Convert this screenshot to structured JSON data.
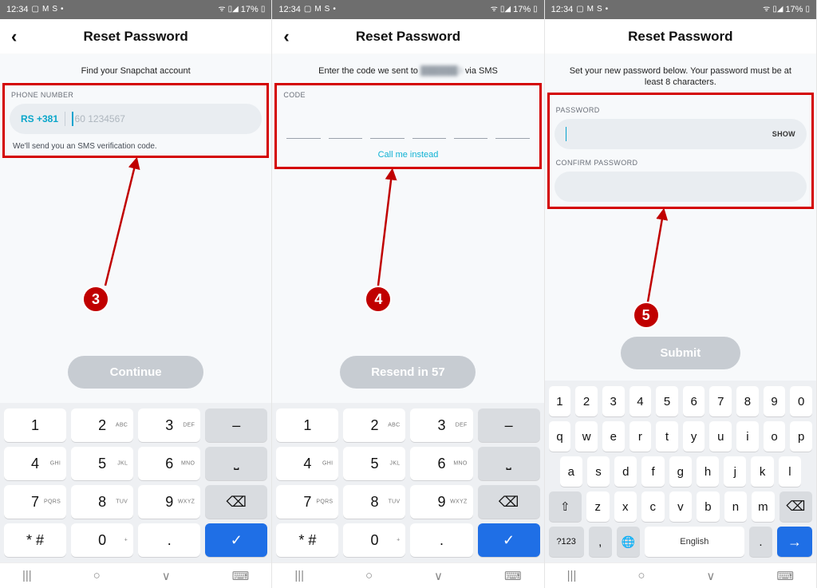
{
  "status": {
    "time": "12:34",
    "battery": "17%",
    "icons_left": [
      "image-icon",
      "mail-icon",
      "skype-icon",
      "dot-icon"
    ],
    "icons_right": [
      "wifi-icon",
      "signal-icon",
      "battery-icon"
    ]
  },
  "screen1": {
    "title": "Reset Password",
    "instruction": "Find your Snapchat account",
    "phone_label": "PHONE NUMBER",
    "cc_prefix": "RS +381",
    "placeholder": "60 1234567",
    "helper": "We'll send you an SMS verification code.",
    "button": "Continue",
    "anno": "3"
  },
  "screen2": {
    "title": "Reset Password",
    "inst_prefix": "Enter the code we sent to ",
    "inst_masked": "██████3",
    "inst_suffix": " via SMS",
    "code_label": "CODE",
    "call_link": "Call me instead",
    "button": "Resend in 57",
    "anno": "4"
  },
  "screen3": {
    "title": "Reset Password",
    "instruction": "Set your new password below. Your password must be at least 8 characters.",
    "pwd_label": "PASSWORD",
    "show": "SHOW",
    "confirm_label": "CONFIRM PASSWORD",
    "button": "Submit",
    "anno": "5"
  },
  "keypad": {
    "rows": [
      [
        {
          "k": "1"
        },
        {
          "k": "2",
          "s": "ABC"
        },
        {
          "k": "3",
          "s": "DEF"
        },
        {
          "k": "–",
          "g": true
        }
      ],
      [
        {
          "k": "4",
          "s": "GHI"
        },
        {
          "k": "5",
          "s": "JKL"
        },
        {
          "k": "6",
          "s": "MNO"
        },
        {
          "k": "␣",
          "g": true,
          "sp": true
        }
      ],
      [
        {
          "k": "7",
          "s": "PQRS"
        },
        {
          "k": "8",
          "s": "TUV"
        },
        {
          "k": "9",
          "s": "WXYZ"
        },
        {
          "k": "⌫",
          "g": true
        }
      ],
      [
        {
          "k": "* #"
        },
        {
          "k": "0",
          "s": "+"
        },
        {
          "k": "."
        },
        {
          "k": "✓",
          "b": true
        }
      ]
    ]
  },
  "kb": {
    "nums": [
      "1",
      "2",
      "3",
      "4",
      "5",
      "6",
      "7",
      "8",
      "9",
      "0"
    ],
    "row1": [
      "q",
      "w",
      "e",
      "r",
      "t",
      "y",
      "u",
      "i",
      "o",
      "p"
    ],
    "row2": [
      "a",
      "s",
      "d",
      "f",
      "g",
      "h",
      "j",
      "k",
      "l"
    ],
    "row3": [
      "z",
      "x",
      "c",
      "v",
      "b",
      "n",
      "m"
    ],
    "shift": "⇧",
    "back": "⌫",
    "k123": "?123",
    "comma": ",",
    "lang": "🌐",
    "space": "English",
    "dot": ".",
    "enter": "→"
  },
  "nav": {
    "recent": "|||",
    "home": "○",
    "back": "∨",
    "kb": "⌨"
  }
}
